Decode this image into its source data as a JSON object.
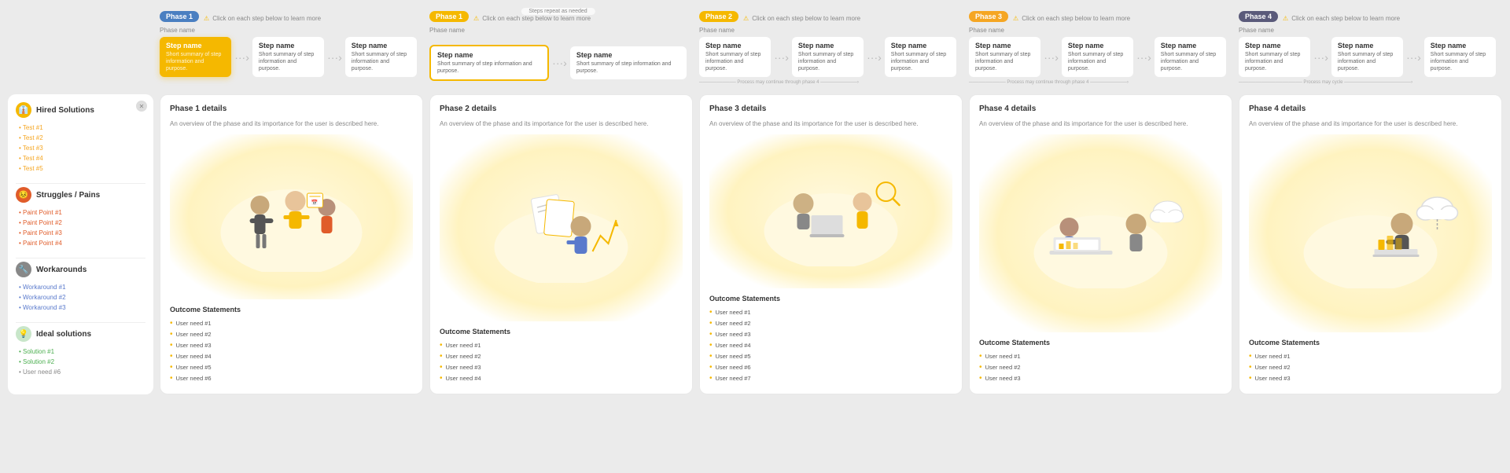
{
  "phases": [
    {
      "id": 1,
      "badge": "Phase 1",
      "badge_color": "blue",
      "hint": "Click on each step below to learn more",
      "phase_name_label": "Phase name",
      "steps": [
        {
          "name": "Step name",
          "summary": "Short summary of step information and purpose.",
          "active": true
        },
        {
          "name": "Step name",
          "summary": "Short summary of step information and purpose."
        },
        {
          "name": "Step name",
          "summary": "Short summary of step information and purpose."
        }
      ],
      "has_continue": false,
      "card_title": "Phase 1 details",
      "card_desc": "An overview of the phase and its importance for the user is described here.",
      "outcomes": [
        "User need #1",
        "User need #2",
        "User need #3",
        "User need #4",
        "User need #5",
        "User need #6"
      ]
    },
    {
      "id": 2,
      "badge": "Phase 1",
      "badge_color": "yellow",
      "hint": "Click on each step below to learn more",
      "phase_name_label": "Phase name",
      "steps": [
        {
          "name": "Step name",
          "summary": "Short summary of step information and purpose."
        },
        {
          "name": "Step name",
          "summary": "Short summary of step information and purpose."
        }
      ],
      "has_continue": false,
      "card_title": "Phase 2 details",
      "card_desc": "An overview of the phase and its importance for the user is described here.",
      "steps_repeat": "Steps repeat as needed",
      "highlighted_step": 1,
      "outcomes": [
        "User need #1",
        "User need #2",
        "User need #3",
        "User need #4"
      ]
    },
    {
      "id": 3,
      "badge": "Phase 2",
      "badge_color": "yellow",
      "hint": "Click on each step below to learn more",
      "phase_name_label": "Phase name",
      "steps": [
        {
          "name": "Step name",
          "summary": "Short summary of step information and purpose."
        },
        {
          "name": "Step name",
          "summary": "Short summary of step information and purpose."
        },
        {
          "name": "Step name",
          "summary": "Short summary of step information and purpose."
        }
      ],
      "has_continue": true,
      "continue_label": "Process may continue through phase 4",
      "card_title": "Phase 3 details",
      "card_desc": "An overview of the phase and its importance for the user is described here.",
      "outcomes": [
        "User need #1",
        "User need #2",
        "User need #3",
        "User need #4",
        "User need #5",
        "User need #6",
        "User need #7"
      ]
    },
    {
      "id": 4,
      "badge": "Phase 3",
      "badge_color": "orange",
      "hint": "Click on each step below to learn more",
      "phase_name_label": "Phase name",
      "steps": [
        {
          "name": "Step name",
          "summary": "Short summary of step information and purpose."
        },
        {
          "name": "Step name",
          "summary": "Short summary of step information and purpose."
        },
        {
          "name": "Step name",
          "summary": "Short summary of step information and purpose."
        }
      ],
      "has_continue": true,
      "continue_label": "Process may continue through phase 4",
      "card_title": "Phase 4 details",
      "card_desc": "An overview of the phase and its importance for the user is described here.",
      "outcomes": [
        "User need #1",
        "User need #2",
        "User need #3"
      ]
    },
    {
      "id": 5,
      "badge": "Phase 4",
      "badge_color": "dark",
      "hint": "Click on each step below to learn more",
      "phase_name_label": "Phase name",
      "steps": [
        {
          "name": "Step name",
          "summary": "Short summary of step information and purpose."
        },
        {
          "name": "Step name",
          "summary": "Short summary of step information and purpose."
        },
        {
          "name": "Step name",
          "summary": "Short summary of step information and purpose."
        }
      ],
      "has_continue": true,
      "continue_label": "Process may cycle",
      "card_title": "Phase 4 details",
      "card_desc": "An overview of the phase and its importance for the user is described here.",
      "outcomes": [
        "User need #1",
        "User need #2",
        "User need #3"
      ]
    }
  ],
  "sidebar": {
    "sections": [
      {
        "id": "hired",
        "icon": "👔",
        "icon_class": "icon-hired",
        "title": "Hired Solutions",
        "items": [
          {
            "label": "• Test #1",
            "class": ""
          },
          {
            "label": "• Test #2",
            "class": ""
          },
          {
            "label": "• Test #3",
            "class": ""
          },
          {
            "label": "• Test #4",
            "class": ""
          },
          {
            "label": "• Test #5",
            "class": ""
          }
        ]
      },
      {
        "id": "struggles",
        "icon": "😣",
        "icon_class": "icon-struggles",
        "title": "Struggles / Pains",
        "items": [
          {
            "label": "• Paint Point #1",
            "class": "pain"
          },
          {
            "label": "• Paint Point #2",
            "class": "pain"
          },
          {
            "label": "• Paint Point #3",
            "class": "pain"
          },
          {
            "label": "• Paint Point #4",
            "class": "pain"
          }
        ]
      },
      {
        "id": "workarounds",
        "icon": "🔧",
        "icon_class": "icon-workarounds",
        "title": "Workarounds",
        "items": [
          {
            "label": "• Workaround #1",
            "class": "workaround"
          },
          {
            "label": "• Workaround #2",
            "class": "workaround"
          },
          {
            "label": "• Workaround #3",
            "class": "workaround"
          }
        ]
      },
      {
        "id": "ideal",
        "icon": "💡",
        "icon_class": "icon-ideal",
        "title": "Ideal solutions",
        "items": [
          {
            "label": "• Solution #1",
            "class": "solution"
          },
          {
            "label": "• Solution #2",
            "class": "solution"
          },
          {
            "label": "• User need #6",
            "class": "user-need"
          }
        ]
      }
    ]
  }
}
